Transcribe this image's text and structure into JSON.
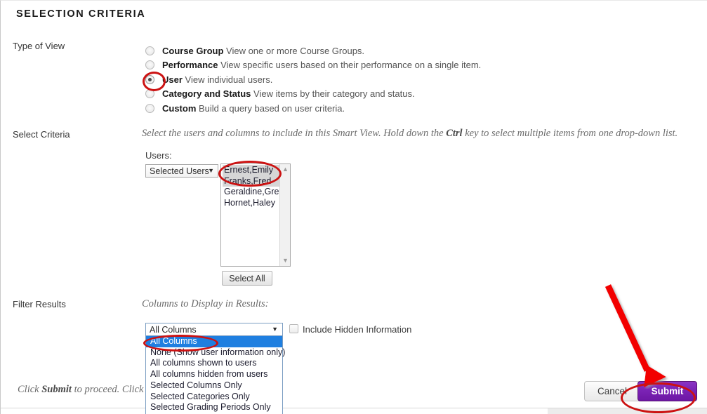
{
  "page": {
    "section_title": "SELECTION CRITERIA"
  },
  "type_of_view": {
    "label": "Type of View",
    "options": [
      {
        "bold": "Course Group",
        "rest": " View one or more Course Groups.",
        "selected": false
      },
      {
        "bold": "Performance",
        "rest": " View specific users based on their performance on a single item.",
        "selected": false
      },
      {
        "bold": "User",
        "rest": " View individual users.",
        "selected": true
      },
      {
        "bold": "Category and Status",
        "rest": " View items by their category and status.",
        "selected": false
      },
      {
        "bold": "Custom",
        "rest": " Build a query based on user criteria.",
        "selected": false
      }
    ]
  },
  "select_criteria": {
    "label": "Select Criteria",
    "instruction_pre": "Select the users and columns to include in this Smart View. Hold down the ",
    "instruction_bold": "Ctrl",
    "instruction_post": " key to select multiple items from one drop-down list.",
    "users_caption": "Users:",
    "users_mode_value": "Selected Users",
    "users_list": [
      {
        "label": "Ernest,Emily",
        "selected": true
      },
      {
        "label": "Franks,Fred",
        "selected": true
      },
      {
        "label": "Geraldine,Greg",
        "selected": false
      },
      {
        "label": "Hornet,Haley",
        "selected": false
      }
    ],
    "select_all_label": "Select All"
  },
  "filter_results": {
    "label": "Filter Results",
    "columns_caption": "Columns to Display in Results:",
    "columns_value": "All Columns",
    "columns_options": [
      {
        "label": "All Columns",
        "highlighted": true
      },
      {
        "label": "None (Show user information only)",
        "highlighted": false
      },
      {
        "label": "All columns shown to users",
        "highlighted": false
      },
      {
        "label": "All columns hidden from users",
        "highlighted": false
      },
      {
        "label": "Selected Columns Only",
        "highlighted": false
      },
      {
        "label": "Selected Categories Only",
        "highlighted": false
      },
      {
        "label": "Selected Grading Periods Only",
        "highlighted": false
      }
    ],
    "include_hidden_label": "Include Hidden Information",
    "include_hidden_checked": false
  },
  "footer": {
    "instruction_pre": "Click ",
    "instruction_bold": "Submit",
    "instruction_post": " to proceed. Click Cancel to go back.",
    "cancel_label": "Cancel",
    "submit_label": "Submit"
  },
  "colors": {
    "annotation_red": "#cc1212",
    "submit_purple": "#7a22b4",
    "dropdown_highlight_blue": "#1f7fe0",
    "listbox_selection_gray": "#d6d6d6"
  },
  "icons": {
    "dropdown_caret": "▼",
    "scroll_up": "▲",
    "scroll_down": "▼"
  }
}
